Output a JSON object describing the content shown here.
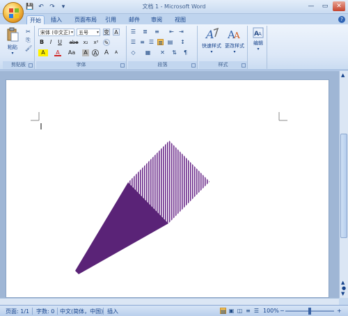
{
  "window": {
    "title": "文档 1 - Microsoft Word"
  },
  "title_controls": [
    "—",
    "▭",
    "✕"
  ],
  "qat": [
    "💾",
    "↶",
    "↷",
    "▾"
  ],
  "tabs": [
    "开始",
    "插入",
    "页面布局",
    "引用",
    "邮件",
    "审阅",
    "视图"
  ],
  "active_tab": "开始",
  "help_glyph": "?",
  "ribbon": {
    "clipboard": {
      "paste_label": "粘贴",
      "group_label": "剪贴板"
    },
    "font": {
      "font_name": "宋体 (中文正)",
      "font_size": "五号",
      "group_label": "字体",
      "buttons": [
        "B",
        "I",
        "U",
        "abe",
        "x₂",
        "x²",
        "A",
        "A",
        "Aa",
        "A",
        "A",
        "A"
      ]
    },
    "paragraph": {
      "group_label": "段落"
    },
    "styles": {
      "quick_styles": "快速样式",
      "change_styles": "更改样式",
      "group_label": "样式"
    },
    "editing": {
      "label": "编辑"
    }
  },
  "status": {
    "page": "页面: 1/1",
    "words": "字数: 0",
    "language": "中文(简体，中国)",
    "mode": "插入",
    "zoom": "100%",
    "zoom_minus": "−",
    "zoom_plus": "+"
  },
  "colors": {
    "shape_fill": "#5a2377",
    "stripe": "#6a2a8a",
    "ribbon_bg": "#dbe7f7"
  }
}
